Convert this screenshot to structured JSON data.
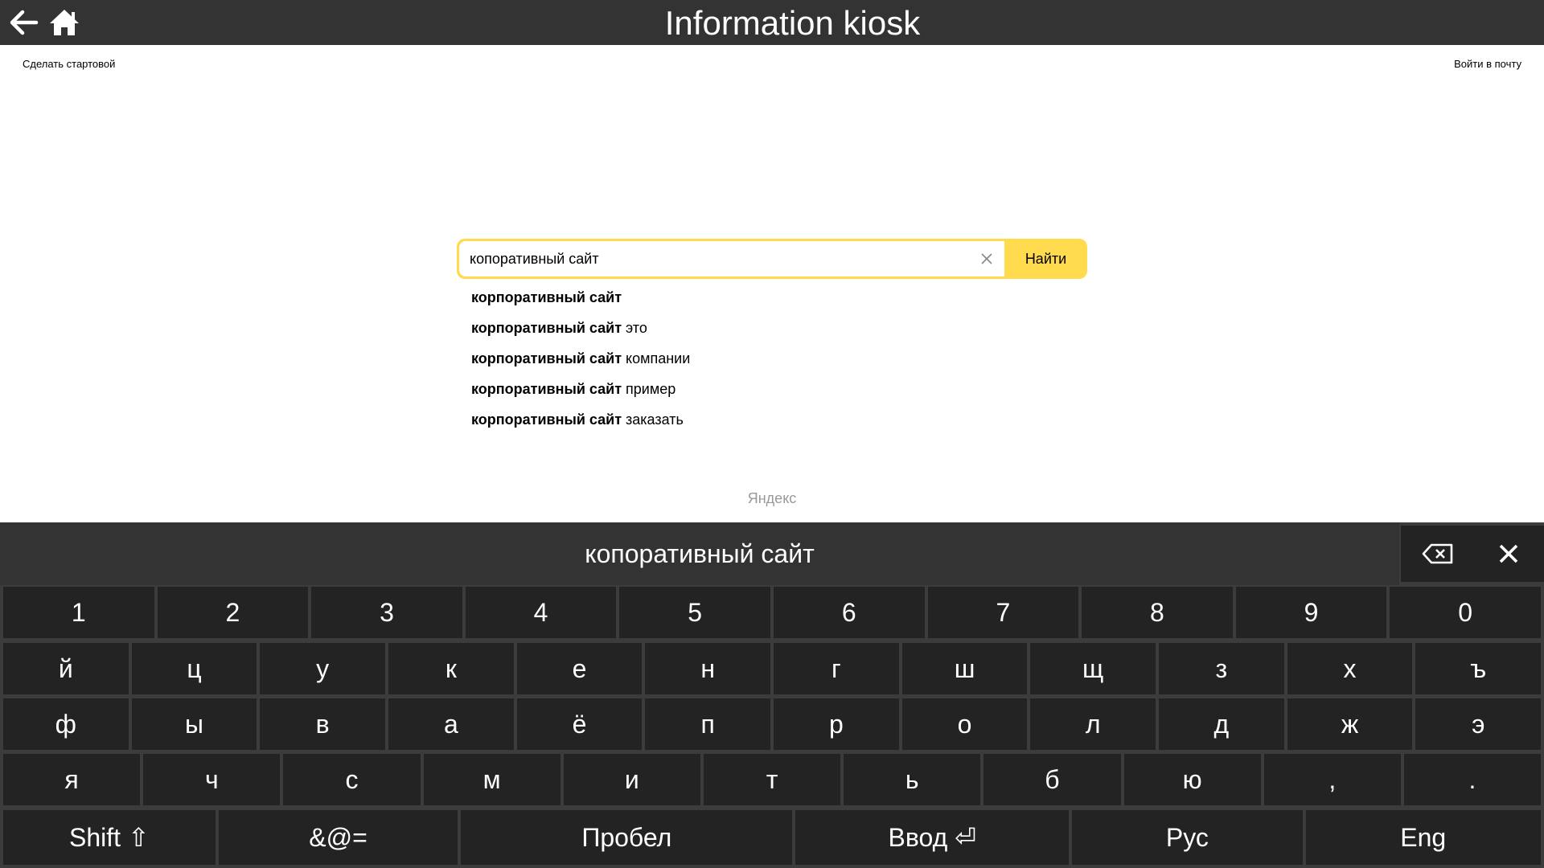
{
  "topbar": {
    "title": "Information kiosk",
    "back_icon": "arrow-left-icon",
    "home_icon": "home-icon"
  },
  "header": {
    "make_start_label": "Сделать стартовой",
    "login_mail_label": "Войти в почту"
  },
  "search": {
    "value": "копоративный сайт",
    "button_label": "Найти",
    "accent_color": "#ffdb4d",
    "clear_icon": "close-icon"
  },
  "suggestions": [
    {
      "bold": "корпоративный сайт",
      "rest": ""
    },
    {
      "bold": "корпоративный сайт",
      "rest": " это"
    },
    {
      "bold": "корпоративный сайт",
      "rest": " компании"
    },
    {
      "bold": "корпоративный сайт",
      "rest": " пример"
    },
    {
      "bold": "корпоративный сайт",
      "rest": " заказать"
    }
  ],
  "brand": "Яндекс",
  "keyboard": {
    "display_text": "копоративный сайт",
    "backspace_icon": "backspace-icon",
    "close_icon": "close-icon",
    "rows": [
      [
        "1",
        "2",
        "3",
        "4",
        "5",
        "6",
        "7",
        "8",
        "9",
        "0"
      ],
      [
        "й",
        "ц",
        "у",
        "к",
        "е",
        "н",
        "г",
        "ш",
        "щ",
        "з",
        "х",
        "ъ"
      ],
      [
        "ф",
        "ы",
        "в",
        "а",
        "ё",
        "п",
        "р",
        "о",
        "л",
        "д",
        "ж",
        "э"
      ],
      [
        "я",
        "ч",
        "с",
        "м",
        "и",
        "т",
        "ь",
        "б",
        "ю",
        ",",
        "."
      ]
    ],
    "bottom": {
      "shift": "Shift ⇧",
      "symbols": "&@=",
      "space": "Пробел",
      "enter": "Ввод ⏎",
      "rus": "Рус",
      "eng": "Eng"
    }
  }
}
